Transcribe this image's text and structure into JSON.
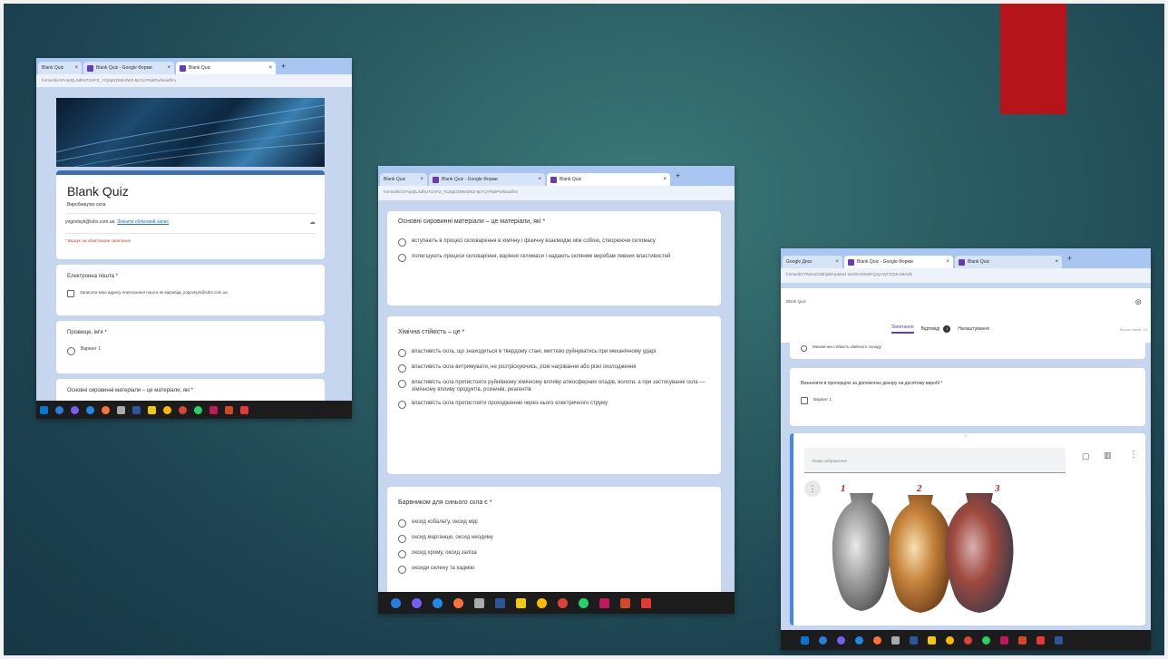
{
  "left": {
    "tabs": [
      "Blank Quiz",
      "Blank Quiz - Google Форми",
      "Blank Quiz"
    ],
    "url": "forms/d/e/1FAIpQLSdl9J7OAFZ_YCj5ptzDWe3WZ-8p7cjYPpkPwfsnadfrm",
    "form_title": "Blank Quiz",
    "form_subtitle": "Виробництво скла",
    "account_email": "yogovtsyk@iuhs.com.ua",
    "switch_account": "Змінити обліковий запис",
    "required_note": "* Вказує на обов'язкове запитання",
    "q1": "Електронна пошта *",
    "q1_check": "Записати мою адресу електронної пошти як відповідь yogovtsyk@iuhs.com.ua",
    "q2": "Прізвище, ім'я *",
    "q2_opt": "Варіант 1",
    "q3": "Основні сировинні матеріали – це матеріали, які *"
  },
  "middle": {
    "tabs": [
      "Blank Quiz",
      "Blank Quiz - Google Форми",
      "Blank Quiz"
    ],
    "url": "forms/d/e/1FAIpQLSdl9J7OAFZ_YCj5ptzDWe3WZ-8p7cjYPpkPwfsnadfrm",
    "q1": "Основні сировинні матеріали – це матеріали, які *",
    "q1_opts": [
      "вступають в процесі скловарення в хімічну і фізичну взаємодію між собою, створюючи скломасу",
      "полегшують процеси скловаріння, варіння скломаси і надають скляним виробам певних властивостей"
    ],
    "q2": "Хімічна стійкість – це *",
    "q2_opts": [
      "властивість скла, що знаходиться в твердому стані, миттєво руйнуватись при механічному ударі",
      "властивість скла витримувати, не розтріскуючись, різкі нагрівання або різкі охолодження",
      "властивість скла протистояти руйнівному хімічному впливу атмосферних опадів, вологи, а при застосуванні скла — хімічному впливу продуктів, розчинів, реагентів",
      "властивість скла протистояти проходженню через нього електричного струму"
    ],
    "q3": "Барвником для синього скла є *",
    "q3_opts": [
      "оксид кобальту, оксид міді",
      "оксид марганцю, оксид неодиму",
      "оксид хрому, оксид заліза",
      "оксиди селену та кадмію"
    ]
  },
  "right": {
    "tabs": [
      "Google Диск",
      "Blank Quiz - Google Форми",
      "Blank Quiz"
    ],
    "url": "forms/d/1TWxHZCiBhjl4EVpMoH-1KZ0HXlIS6FQ1yV2jTGQ4Uv8/edit",
    "toolbar_label": "Blank Quiz",
    "tab_questions": "Запитання",
    "tab_responses": "Відповіді",
    "responses_count": "1",
    "tab_settings": "Налаштування",
    "total_points": "Всього балів: 10",
    "prev_item": "Механічна стійкість хімічного складу",
    "q1": "Визначити в пропорціях за допомогою декору на десятому виробі *",
    "q1_opt": "Варіант 1",
    "image_title_placeholder": "Назва зображення",
    "vase_numbers": [
      "1",
      "2",
      "3"
    ]
  },
  "colors": {
    "accent_red": "#b5141a",
    "form_purple": "#673ab7",
    "form_blue_bar": "#1a73e8"
  }
}
